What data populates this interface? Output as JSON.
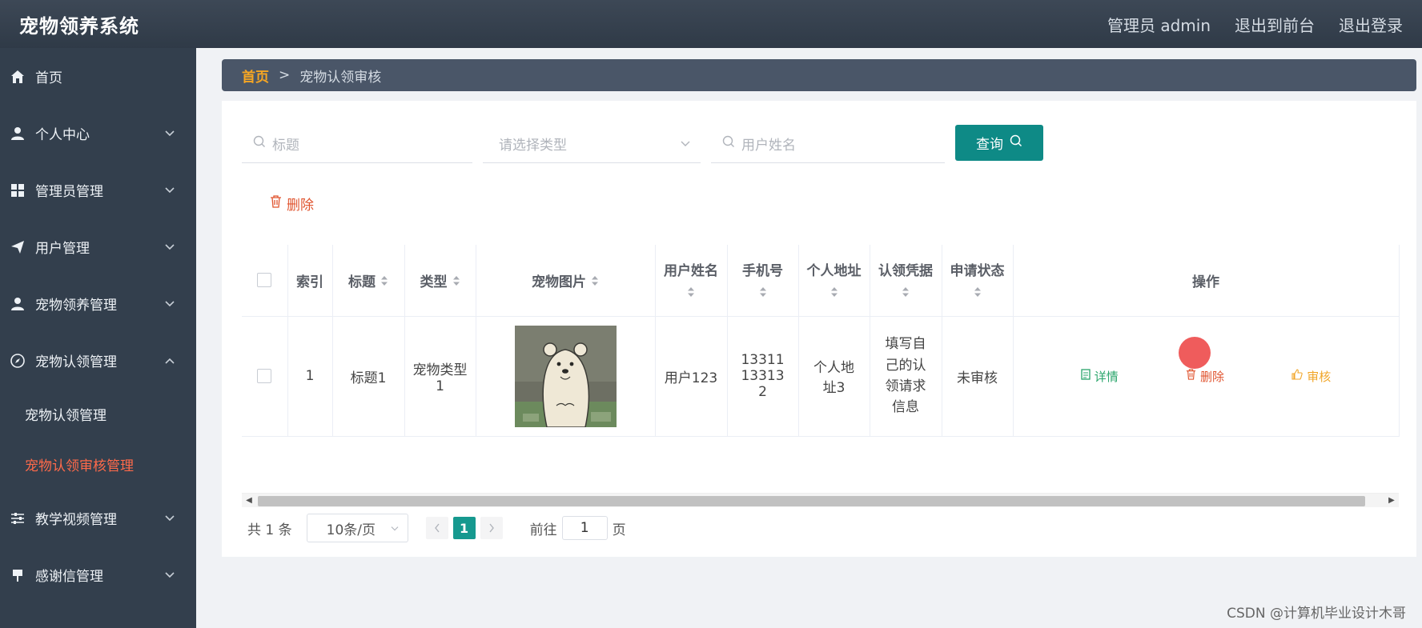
{
  "app": {
    "title": "宠物领养系统",
    "admin_label": "管理员 admin",
    "goto_front": "退出到前台",
    "logout": "退出登录"
  },
  "sidebar": {
    "items": [
      {
        "label": "首页",
        "icon": "home-icon"
      },
      {
        "label": "个人中心",
        "icon": "user-icon"
      },
      {
        "label": "管理员管理",
        "icon": "grid-icon"
      },
      {
        "label": "用户管理",
        "icon": "send-icon"
      },
      {
        "label": "宠物领养管理",
        "icon": "user-icon"
      },
      {
        "label": "宠物认领管理",
        "icon": "compass-icon"
      }
    ],
    "sub_items": [
      {
        "label": "宠物认领管理"
      },
      {
        "label": "宠物认领审核管理"
      }
    ],
    "items_after": [
      {
        "label": "教学视频管理",
        "icon": "sliders-icon"
      },
      {
        "label": "感谢信管理",
        "icon": "pin-icon"
      }
    ]
  },
  "breadcrumb": {
    "home": "首页",
    "sep": ">",
    "current": "宠物认领审核"
  },
  "search": {
    "title_placeholder": "标题",
    "type_placeholder": "请选择类型",
    "username_placeholder": "用户姓名",
    "query_label": "查询"
  },
  "toolbar": {
    "delete_label": "删除"
  },
  "table": {
    "headers": {
      "index": "索引",
      "title": "标题",
      "type": "类型",
      "pet_image": "宠物图片",
      "username": "用户姓名",
      "phone": "手机号",
      "address": "个人地址",
      "proof": "认领凭据",
      "status": "申请状态",
      "actions": "操作"
    },
    "rows": [
      {
        "index": "1",
        "title": "标题1",
        "type": "宠物类型1",
        "username": "用户123",
        "phone": "13311133132",
        "address": "个人地址3",
        "proof": "填写自己的认领请求信息",
        "status": "未审核",
        "detail": "详情",
        "delete": "删除",
        "audit": "审核"
      }
    ]
  },
  "pagination": {
    "total": "共 1 条",
    "page_size": "10条/页",
    "current_page": "1",
    "goto_prefix": "前往",
    "goto_value": "1",
    "goto_suffix": "页"
  },
  "watermark": "CSDN @计算机毕业设计木哥",
  "colors": {
    "accent": "#0e8a86",
    "active_menu": "#ff6a4a",
    "breadcrumb_home": "#f6a623",
    "sidebar_bg": "#333f4d",
    "topbar_bg": "#2f3a47"
  }
}
